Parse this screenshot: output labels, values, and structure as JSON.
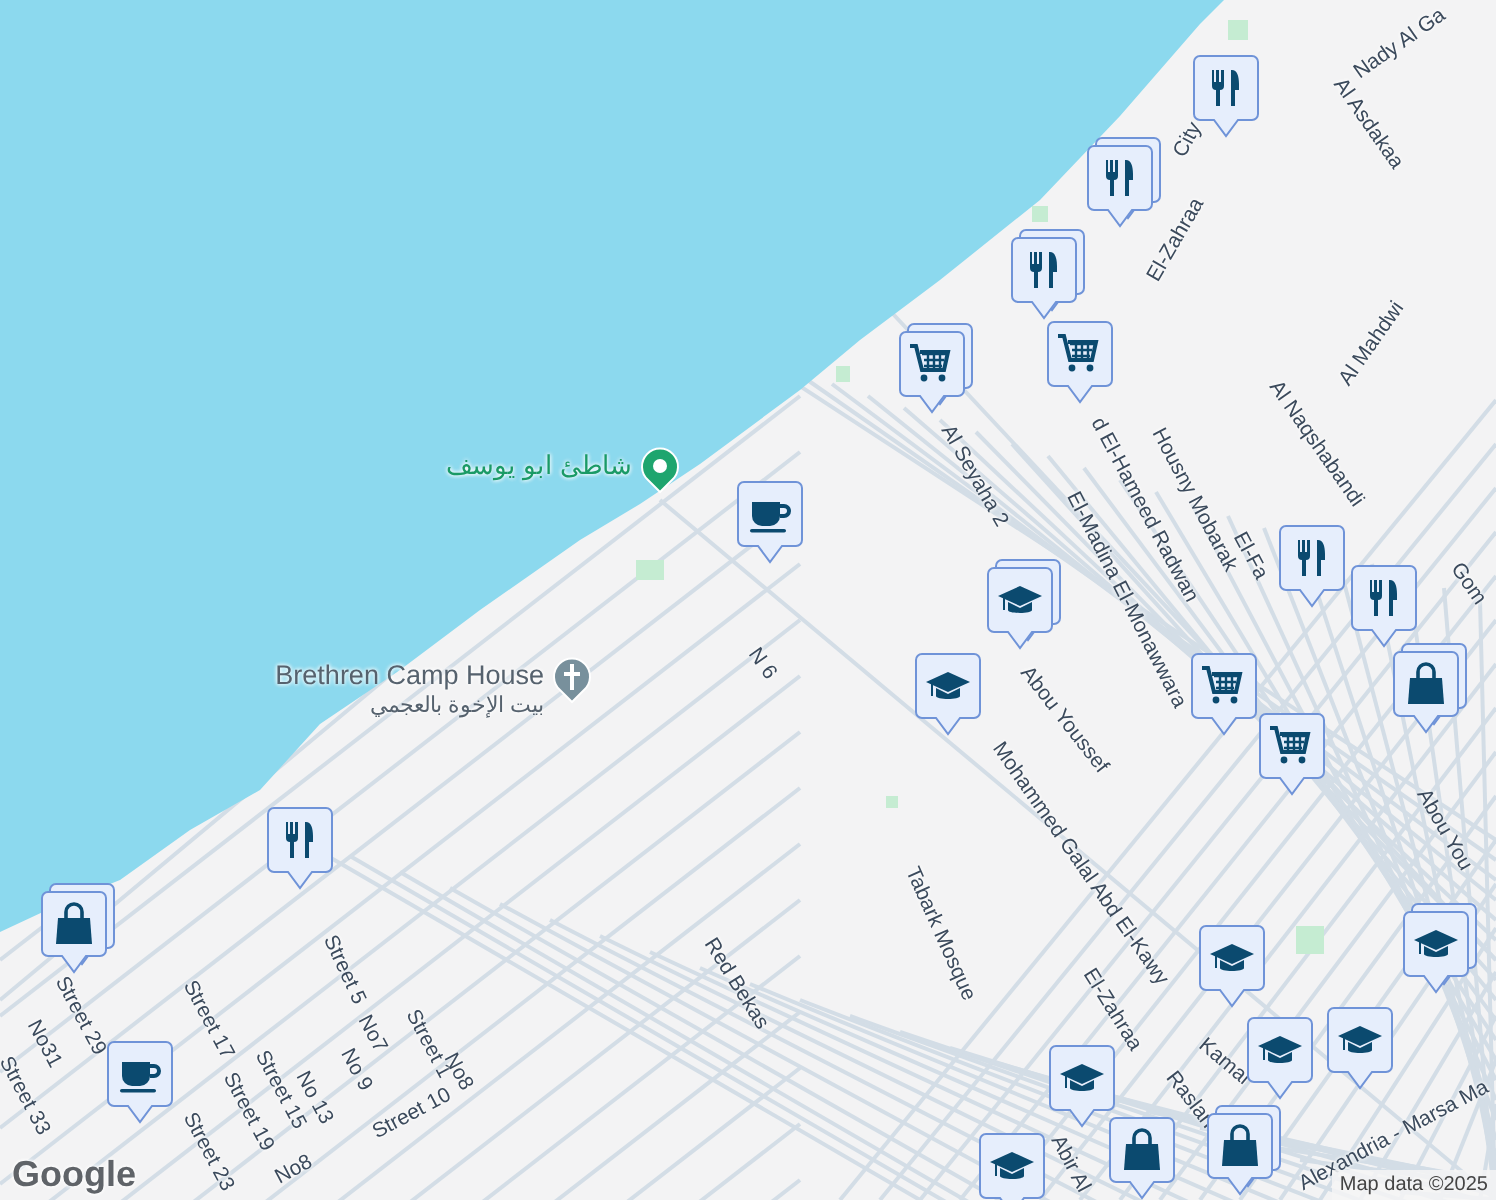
{
  "places": [
    {
      "kind": "beach",
      "name": "شاطئ ابو يوسف"
    },
    {
      "kind": "church",
      "name": "Brethren Camp House",
      "subtitle": "بيت الإخوة بالعجمي"
    }
  ],
  "street_labels": [
    "Nady Al Ga",
    "City",
    "El-Zahraa",
    "Al Asdakaa",
    "Al Mahdwi",
    "Al Seyaha 2",
    "d El-Hameed Radwan",
    "Housny Mobarak",
    "El-Madina El-Monawwara",
    "Al Naqshabandi",
    "El-Fa",
    "Gom",
    "N 6",
    "Abou Youssef",
    "Mohammed Galal Abd El-Kawy",
    "Tabark Mosque",
    "Red Bekas",
    "El-Zahraa",
    "Kamal",
    "Raslan",
    "Abir Al",
    "Alexandria - Marsa Ma",
    "Abou You",
    "Street 5",
    "No7",
    "No 9",
    "Street 1",
    "No8",
    "Street 10",
    "No 13",
    "Street 15",
    "Street 19",
    "Street 17",
    "No8",
    "Street 29",
    "No31",
    "Street 33",
    "Street 23"
  ],
  "markers": [
    {
      "kind": "restaurant",
      "stacked": false
    },
    {
      "kind": "restaurant",
      "stacked": true
    },
    {
      "kind": "restaurant",
      "stacked": true
    },
    {
      "kind": "grocery",
      "stacked": false
    },
    {
      "kind": "grocery",
      "stacked": true
    },
    {
      "kind": "cafe",
      "stacked": false
    },
    {
      "kind": "restaurant",
      "stacked": false
    },
    {
      "kind": "restaurant",
      "stacked": false
    },
    {
      "kind": "school",
      "stacked": true
    },
    {
      "kind": "school",
      "stacked": false
    },
    {
      "kind": "shopping",
      "stacked": true
    },
    {
      "kind": "grocery",
      "stacked": false
    },
    {
      "kind": "grocery",
      "stacked": false
    },
    {
      "kind": "restaurant",
      "stacked": false
    },
    {
      "kind": "shopping",
      "stacked": true
    },
    {
      "kind": "cafe",
      "stacked": false
    },
    {
      "kind": "school",
      "stacked": false
    },
    {
      "kind": "school",
      "stacked": false
    },
    {
      "kind": "school",
      "stacked": false
    },
    {
      "kind": "school",
      "stacked": true
    },
    {
      "kind": "school",
      "stacked": false
    },
    {
      "kind": "shopping",
      "stacked": false
    },
    {
      "kind": "shopping",
      "stacked": true
    },
    {
      "kind": "school",
      "stacked": false
    }
  ],
  "attribution": {
    "logo": "Google",
    "text": "Map data ©2025"
  }
}
